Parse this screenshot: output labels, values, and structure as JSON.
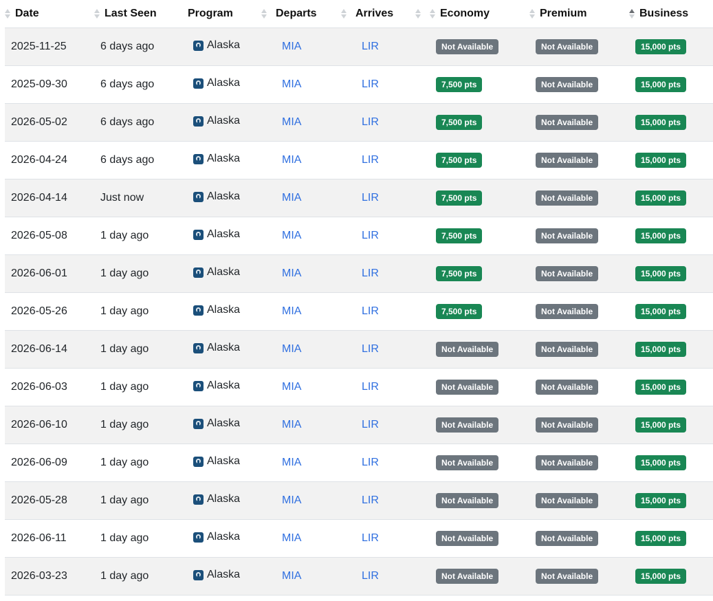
{
  "columns": [
    {
      "key": "date",
      "label": "Date",
      "sort": "none",
      "leading_sort": true
    },
    {
      "key": "last_seen",
      "label": "Last Seen",
      "sort": "none",
      "leading_sort": true
    },
    {
      "key": "program",
      "label": "Program",
      "sort": "none",
      "leading_sort": false
    },
    {
      "key": "departs",
      "label": "Departs",
      "sort": "none",
      "leading_sort": false
    },
    {
      "key": "arrives",
      "label": "Arrives",
      "sort": "none",
      "leading_sort": false
    },
    {
      "key": "economy",
      "label": "Economy",
      "sort": "none",
      "leading_sort": true
    },
    {
      "key": "premium",
      "label": "Premium",
      "sort": "none",
      "leading_sort": true
    },
    {
      "key": "business",
      "label": "Business",
      "sort": "asc",
      "leading_sort": true
    }
  ],
  "icons": {
    "program_logo": "alaska-airlines-logo-icon",
    "sort": "sort-arrows-icon"
  },
  "colors": {
    "available": "#198754",
    "not_available": "#6c757d",
    "link": "#2f6fe0",
    "row_stripe": "#f2f2f2"
  },
  "rows": [
    {
      "date": "2025-11-25",
      "last_seen": "6 days ago",
      "program": "Alaska",
      "departs": "MIA",
      "arrives": "LIR",
      "economy": "Not Available",
      "premium": "Not Available",
      "business": "15,000 pts"
    },
    {
      "date": "2025-09-30",
      "last_seen": "6 days ago",
      "program": "Alaska",
      "departs": "MIA",
      "arrives": "LIR",
      "economy": "7,500 pts",
      "premium": "Not Available",
      "business": "15,000 pts"
    },
    {
      "date": "2026-05-02",
      "last_seen": "6 days ago",
      "program": "Alaska",
      "departs": "MIA",
      "arrives": "LIR",
      "economy": "7,500 pts",
      "premium": "Not Available",
      "business": "15,000 pts"
    },
    {
      "date": "2026-04-24",
      "last_seen": "6 days ago",
      "program": "Alaska",
      "departs": "MIA",
      "arrives": "LIR",
      "economy": "7,500 pts",
      "premium": "Not Available",
      "business": "15,000 pts"
    },
    {
      "date": "2026-04-14",
      "last_seen": "Just now",
      "program": "Alaska",
      "departs": "MIA",
      "arrives": "LIR",
      "economy": "7,500 pts",
      "premium": "Not Available",
      "business": "15,000 pts"
    },
    {
      "date": "2026-05-08",
      "last_seen": "1 day ago",
      "program": "Alaska",
      "departs": "MIA",
      "arrives": "LIR",
      "economy": "7,500 pts",
      "premium": "Not Available",
      "business": "15,000 pts"
    },
    {
      "date": "2026-06-01",
      "last_seen": "1 day ago",
      "program": "Alaska",
      "departs": "MIA",
      "arrives": "LIR",
      "economy": "7,500 pts",
      "premium": "Not Available",
      "business": "15,000 pts"
    },
    {
      "date": "2026-05-26",
      "last_seen": "1 day ago",
      "program": "Alaska",
      "departs": "MIA",
      "arrives": "LIR",
      "economy": "7,500 pts",
      "premium": "Not Available",
      "business": "15,000 pts"
    },
    {
      "date": "2026-06-14",
      "last_seen": "1 day ago",
      "program": "Alaska",
      "departs": "MIA",
      "arrives": "LIR",
      "economy": "Not Available",
      "premium": "Not Available",
      "business": "15,000 pts"
    },
    {
      "date": "2026-06-03",
      "last_seen": "1 day ago",
      "program": "Alaska",
      "departs": "MIA",
      "arrives": "LIR",
      "economy": "Not Available",
      "premium": "Not Available",
      "business": "15,000 pts"
    },
    {
      "date": "2026-06-10",
      "last_seen": "1 day ago",
      "program": "Alaska",
      "departs": "MIA",
      "arrives": "LIR",
      "economy": "Not Available",
      "premium": "Not Available",
      "business": "15,000 pts"
    },
    {
      "date": "2026-06-09",
      "last_seen": "1 day ago",
      "program": "Alaska",
      "departs": "MIA",
      "arrives": "LIR",
      "economy": "Not Available",
      "premium": "Not Available",
      "business": "15,000 pts"
    },
    {
      "date": "2026-05-28",
      "last_seen": "1 day ago",
      "program": "Alaska",
      "departs": "MIA",
      "arrives": "LIR",
      "economy": "Not Available",
      "premium": "Not Available",
      "business": "15,000 pts"
    },
    {
      "date": "2026-06-11",
      "last_seen": "1 day ago",
      "program": "Alaska",
      "departs": "MIA",
      "arrives": "LIR",
      "economy": "Not Available",
      "premium": "Not Available",
      "business": "15,000 pts"
    },
    {
      "date": "2026-03-23",
      "last_seen": "1 day ago",
      "program": "Alaska",
      "departs": "MIA",
      "arrives": "LIR",
      "economy": "Not Available",
      "premium": "Not Available",
      "business": "15,000 pts"
    }
  ]
}
